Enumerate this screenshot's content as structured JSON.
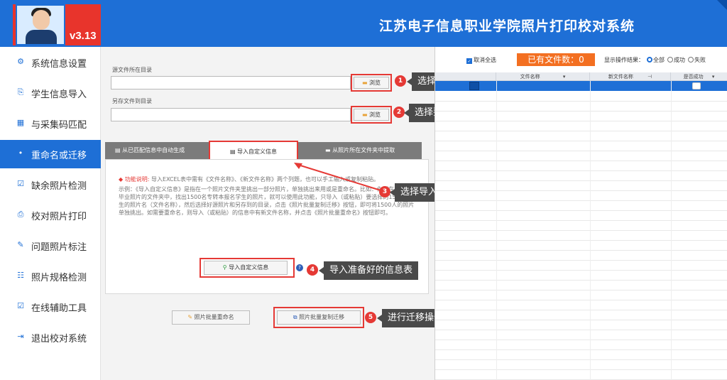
{
  "app": {
    "title": "江苏电子信息职业学院照片打印校对系统",
    "version": "v3.13",
    "colors": {
      "header": "#1e6fd6",
      "accent_red": "#e53935",
      "orange": "#f36f21"
    }
  },
  "sidebar": {
    "items": [
      {
        "label": "系统信息设置",
        "icon": "gear-icon"
      },
      {
        "label": "学生信息导入",
        "icon": "import-icon"
      },
      {
        "label": "与采集码匹配",
        "icon": "grid-icon"
      },
      {
        "label": "重命名或迁移",
        "icon": "dot-icon",
        "active": true
      },
      {
        "label": "缺余照片检测",
        "icon": "check-icon"
      },
      {
        "label": "校对照片打印",
        "icon": "print-icon"
      },
      {
        "label": "问题照片标注",
        "icon": "mark-icon"
      },
      {
        "label": "照片规格检测",
        "icon": "spec-icon"
      },
      {
        "label": "在线辅助工具",
        "icon": "tools-icon"
      },
      {
        "label": "退出校对系统",
        "icon": "exit-icon"
      }
    ]
  },
  "form": {
    "source_label": "源文件所在目录",
    "source_value": "",
    "target_label": "另存文件到目录",
    "target_value": "",
    "browse_label": "浏览"
  },
  "tabs": [
    {
      "label": "从已匹配信息中自动生成"
    },
    {
      "label": "导入自定义信息",
      "active": true
    },
    {
      "label": "从照片所在文件夹中提取"
    }
  ],
  "description": {
    "title": "功能说明:",
    "line1": "导入EXCEL表中需有《文件名称》、《新文件名称》两个列题，也可以手工输入或复制粘贴。",
    "body": "示例：《导入自定义信息》是指在一个照片文件夹里挑出一部分照片，单独挑出来用或是重命名。比如：你想在4000张毕业照片的文件夹中，找出1500名专转本报名学生的照片，就可以使用此功能，只导入（或粘贴）要选择的1500名学生的照片名（文件名称），然后选择好源照片和另存到的目录，点击《照片批量复制迁移》按钮，即可将1500人的照片单独挑出。如需要重命名，则导入（或粘贴）的信息中有新文件名称，并点击《照片批量重命名》按钮即可。"
  },
  "buttons": {
    "import_custom": "导入自定义信息",
    "batch_rename": "照片批量重命名",
    "batch_copy_move": "照片批量复制迁移"
  },
  "callouts": [
    {
      "num": "1",
      "text": "选择照片存放的位置"
    },
    {
      "num": "2",
      "text": "选择要迁移照片另存放的位置"
    },
    {
      "num": "3",
      "text": "选择导入自定义信息"
    },
    {
      "num": "4",
      "text": "导入准备好的信息表"
    },
    {
      "num": "5",
      "text": "进行迁移操作"
    }
  ],
  "right_panel": {
    "cancel_all": "取消全选",
    "file_count": "已有文件数：0",
    "result_label": "显示操作结果：",
    "result_options": [
      "全部",
      "成功",
      "失败"
    ],
    "result_selected": "全部",
    "columns": [
      "文件名称",
      "新文件名称",
      "是否成功"
    ]
  }
}
